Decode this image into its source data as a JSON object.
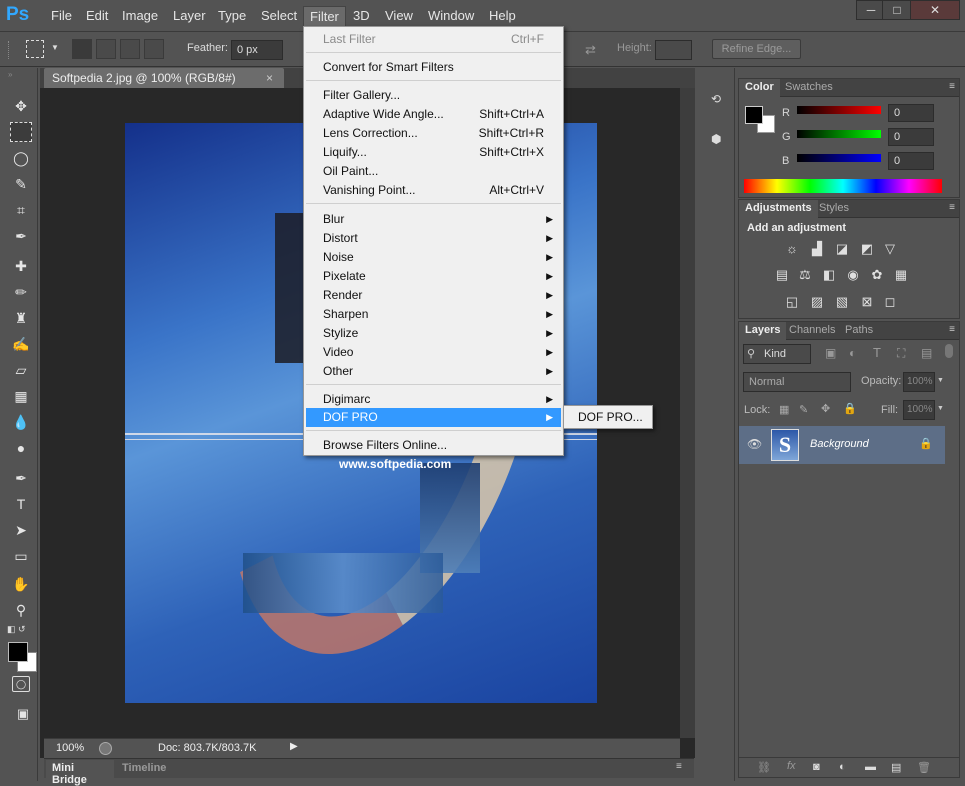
{
  "app": {
    "logo": "Ps"
  },
  "menubar": {
    "items": [
      "File",
      "Edit",
      "Image",
      "Layer",
      "Type",
      "Select",
      "Filter",
      "3D",
      "View",
      "Window",
      "Help"
    ],
    "window_buttons": {
      "minimize": "─",
      "maximize": "□",
      "close": "✕"
    }
  },
  "options": {
    "feather_label": "Feather:",
    "feather_value": "0 px",
    "height_label": "Height:",
    "refine_edge": "Refine Edge..."
  },
  "document": {
    "tab_title": "Softpedia 2.jpg @ 100% (RGB/8#)",
    "close": "×",
    "zoom": "100%",
    "doc_size": "Doc: 803.7K/803.7K",
    "watermark_url": "www.softpedia.com"
  },
  "bottom_tabs": [
    "Mini Bridge",
    "Timeline"
  ],
  "color_panel": {
    "tabs": [
      "Color",
      "Swatches"
    ],
    "r_label": "R",
    "g_label": "G",
    "b_label": "B",
    "r_value": "0",
    "g_value": "0",
    "b_value": "0"
  },
  "adjustments_panel": {
    "tabs": [
      "Adjustments",
      "Styles"
    ],
    "title": "Add an adjustment"
  },
  "layers_panel": {
    "tabs": [
      "Layers",
      "Channels",
      "Paths"
    ],
    "kind": "Kind",
    "blend_mode": "Normal",
    "opacity_label": "Opacity:",
    "opacity_value": "100%",
    "lock_label": "Lock:",
    "fill_label": "Fill:",
    "fill_value": "100%",
    "layers": [
      {
        "name": "Background",
        "thumb": "S"
      }
    ]
  },
  "filter_menu": {
    "last_filter": {
      "label": "Last Filter",
      "shortcut": "Ctrl+F"
    },
    "convert": "Convert for Smart Filters",
    "group1": [
      {
        "label": "Filter Gallery...",
        "shortcut": ""
      },
      {
        "label": "Adaptive Wide Angle...",
        "shortcut": "Shift+Ctrl+A"
      },
      {
        "label": "Lens Correction...",
        "shortcut": "Shift+Ctrl+R"
      },
      {
        "label": "Liquify...",
        "shortcut": "Shift+Ctrl+X"
      },
      {
        "label": "Oil Paint...",
        "shortcut": ""
      },
      {
        "label": "Vanishing Point...",
        "shortcut": "Alt+Ctrl+V"
      }
    ],
    "group2": [
      "Blur",
      "Distort",
      "Noise",
      "Pixelate",
      "Render",
      "Sharpen",
      "Stylize",
      "Video",
      "Other"
    ],
    "group3": [
      "Digimarc",
      "DOF PRO"
    ],
    "browse": "Browse Filters Online...",
    "submenu_item": "DOF PRO...",
    "arrow": "▶"
  },
  "colors": {
    "accent": "#3399ff",
    "logo": "#31a8ff",
    "selected_layer": "#5d6e87"
  }
}
